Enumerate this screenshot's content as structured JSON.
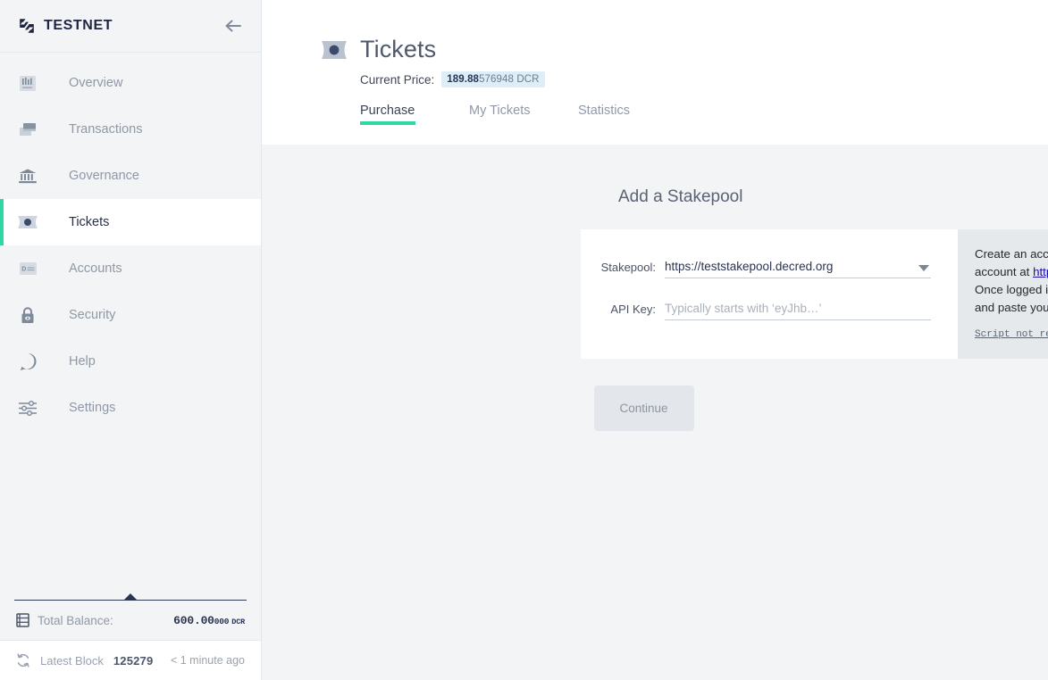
{
  "sidebar": {
    "logo_text": "TESTNET",
    "logo_icon": "decred-logo-icon",
    "back_icon": "back-arrow-icon",
    "items": [
      {
        "label": "Overview",
        "icon": "chart-overview-icon",
        "active": false
      },
      {
        "label": "Transactions",
        "icon": "transactions-icon",
        "active": false
      },
      {
        "label": "Governance",
        "icon": "bank-governance-icon",
        "active": false
      },
      {
        "label": "Tickets",
        "icon": "ticket-icon",
        "active": true
      },
      {
        "label": "Accounts",
        "icon": "accounts-card-icon",
        "active": false
      },
      {
        "label": "Security",
        "icon": "lock-security-icon",
        "active": false
      },
      {
        "label": "Help",
        "icon": "question-help-icon",
        "active": false
      },
      {
        "label": "Settings",
        "icon": "sliders-settings-icon",
        "active": false
      }
    ],
    "status": {
      "balance_icon": "balance-ledger-icon",
      "balance_label": "Total Balance:",
      "balance_whole": "600.00",
      "balance_fraction": "000",
      "balance_unit": "DCR",
      "sync_icon": "refresh-sync-icon",
      "block_label": "Latest Block",
      "block_number": "125279",
      "block_time": "< 1 minute ago"
    }
  },
  "header": {
    "title_icon": "ticket-icon",
    "title": "Tickets",
    "price_label": "Current Price:",
    "price_whole": "189.88",
    "price_rest": "576948 DCR",
    "tabs": [
      {
        "label": "Purchase",
        "active": true
      },
      {
        "label": "My Tickets",
        "active": false
      },
      {
        "label": "Statistics",
        "active": false
      }
    ]
  },
  "main": {
    "section_title": "Add a Stakepool",
    "form": {
      "stakepool_label": "Stakepool:",
      "stakepool_value": "https://teststakepool.decred.org",
      "stakepool_caret_icon": "chevron-down-icon",
      "apikey_label": "API Key:",
      "apikey_value": "",
      "apikey_placeholder": "Typically starts with ‘eyJhb…’"
    },
    "info": {
      "line1_pre": "Create an account or login to your existing account at ",
      "link_text": "https://teststakepool.decred.org",
      "line2": "Once logged in, select the ‘Settings’ tab, copy and paste your API KEY into the field.",
      "script_link": "Script not redeemable?",
      "download_icon": "download-icon"
    },
    "continue_label": "Continue"
  },
  "colors": {
    "accent_green": "#2ed8a3",
    "navy": "#1d2542",
    "muted_text": "#8f98a6",
    "badge_bg": "#ddeef9",
    "info_bg": "#e5e9ec",
    "link_blue": "#1a0dab"
  }
}
